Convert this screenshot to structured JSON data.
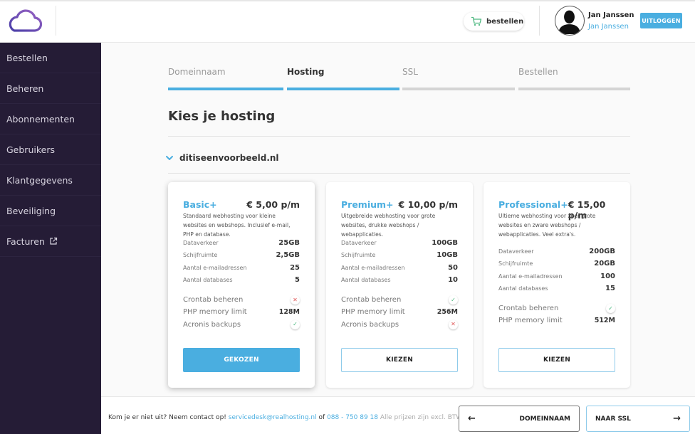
{
  "header": {
    "logo": "cloud-logo",
    "cart_label": "bestellen",
    "user_name": "Jan Janssen",
    "user_sub": "Jan Janssen",
    "logout_label": "UITLOGGEN"
  },
  "sidebar": {
    "items": [
      {
        "label": "Bestellen"
      },
      {
        "label": "Beheren"
      },
      {
        "label": "Abonnementen"
      },
      {
        "label": "Gebruikers"
      },
      {
        "label": "Klantgegevens"
      },
      {
        "label": "Beveiliging"
      },
      {
        "label": "Facturen",
        "icon": "external-link-icon"
      }
    ]
  },
  "steps": [
    {
      "label": "Domeinnaam",
      "state": "done"
    },
    {
      "label": "Hosting",
      "state": "active"
    },
    {
      "label": "SSL",
      "state": "todo"
    },
    {
      "label": "Bestellen",
      "state": "todo"
    }
  ],
  "main": {
    "title": "Kies je hosting",
    "domain": "ditiseenvoorbeeld.nl"
  },
  "plans": [
    {
      "name": "Basic+",
      "price": "€ 5,00 p/m",
      "description": "Standaard webhosting voor kleine websites en webshops. Inclusief e-mail, PHP en database.",
      "specs": [
        {
          "label": "Dataverkeer",
          "value": "25GB"
        },
        {
          "label": "Schijfruimte",
          "value": "2,5GB"
        },
        {
          "label": "Aantal e-mailadressen",
          "value": "25"
        },
        {
          "label": "Aantal databases",
          "value": "5"
        }
      ],
      "features": [
        {
          "label": "Crontab beheren",
          "type": "bool",
          "value": "no"
        },
        {
          "label": "PHP memory limit",
          "type": "text",
          "value": "128M"
        },
        {
          "label": "Acronis backups",
          "type": "bool",
          "value": "yes"
        }
      ],
      "button": "GEKOZEN",
      "selected": true
    },
    {
      "name": "Premium+",
      "price": "€ 10,00 p/m",
      "description": "Uitgebreide webhosting voor grote websites, drukke webshops / webapplicaties.",
      "specs": [
        {
          "label": "Dataverkeer",
          "value": "100GB"
        },
        {
          "label": "Schijfruimte",
          "value": "10GB"
        },
        {
          "label": "Aantal e-mailadressen",
          "value": "50"
        },
        {
          "label": "Aantal databases",
          "value": "10"
        }
      ],
      "features": [
        {
          "label": "Crontab beheren",
          "type": "bool",
          "value": "yes"
        },
        {
          "label": "PHP memory limit",
          "type": "text",
          "value": "256M"
        },
        {
          "label": "Acronis backups",
          "type": "bool",
          "value": "no"
        }
      ],
      "button": "KIEZEN",
      "selected": false
    },
    {
      "name": "Professional+",
      "price": "€ 15,00 p/m",
      "description": "Ultieme webhosting voor zeer grote websites en zware webshops / webapplicaties. Veel extra's.",
      "specs": [
        {
          "label": "Dataverkeer",
          "value": "200GB"
        },
        {
          "label": "Schijfruimte",
          "value": "20GB"
        },
        {
          "label": "Aantal e-mailadressen",
          "value": "100"
        },
        {
          "label": "Aantal databases",
          "value": "15"
        }
      ],
      "features": [
        {
          "label": "Crontab beheren",
          "type": "bool",
          "value": "yes"
        },
        {
          "label": "PHP memory limit",
          "type": "text",
          "value": "512M"
        }
      ],
      "button": "KIEZEN",
      "selected": false
    }
  ],
  "footer": {
    "help_text": "Kom je er niet uit? Neem contact op!",
    "email": "servicedesk@realhosting.nl",
    "or": "of",
    "phone": "088 - 750 89 18",
    "note": "Alle prijzen zijn excl. BTW",
    "back_label": "DOMEINNAAM",
    "next_label": "NAAR SSL"
  },
  "colors": {
    "accent": "#4aaee0",
    "sidebar_bg": "#251c36",
    "yes": "#4cb87f",
    "no": "#e05a5a"
  }
}
